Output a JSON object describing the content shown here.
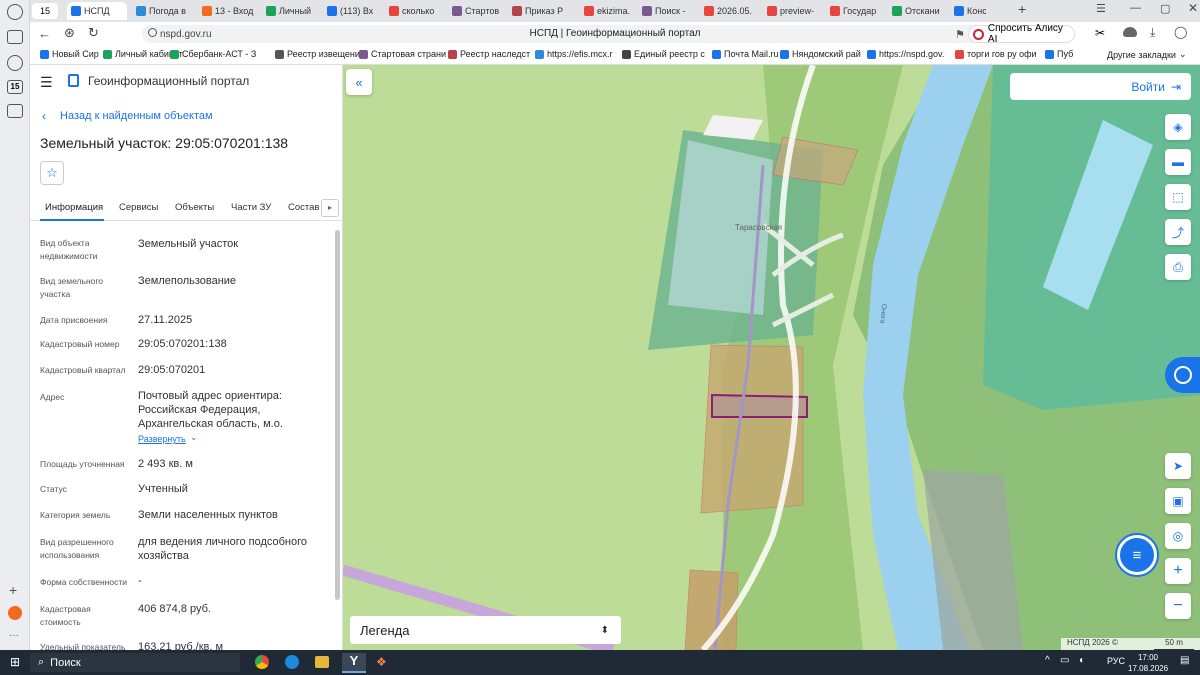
{
  "browser": {
    "tab_count": "15",
    "tabs": [
      {
        "label": "НСПД",
        "color": "#1a73e8"
      },
      {
        "label": "Погода в",
        "color": "#2e8bd6"
      },
      {
        "label": "13 - Вход",
        "color": "#f26b1d"
      },
      {
        "label": "Личный",
        "color": "#1aa35a"
      },
      {
        "label": "(113) Вх",
        "color": "#1a73e8"
      },
      {
        "label": "сколько",
        "color": "#e8453c"
      },
      {
        "label": "Стартов",
        "color": "#7a5a8c"
      },
      {
        "label": "Приказ Р",
        "color": "#b8424b"
      },
      {
        "label": "ekizima.",
        "color": "#e8453c"
      },
      {
        "label": "Поиск -",
        "color": "#7a5a8c"
      },
      {
        "label": "2026.05.",
        "color": "#e8453c"
      },
      {
        "label": "preview-",
        "color": "#e8453c"
      },
      {
        "label": "Государ",
        "color": "#e8453c"
      },
      {
        "label": "Отскани",
        "color": "#1aa35a"
      },
      {
        "label": "Консоль",
        "color": "#1a73e8"
      }
    ],
    "url": "nspd.gov.ru",
    "page_title": "НСПД | Геоинформационный портал",
    "alice_label": "Спросить Алису AI",
    "bookmarks": [
      {
        "label": "Новый Сир",
        "color": "#1a73e8"
      },
      {
        "label": "Личный кабинет",
        "color": "#1aa35a"
      },
      {
        "label": "Сбербанк-АСТ - З",
        "color": "#1aa35a"
      },
      {
        "label": "Реестр извещени",
        "color": "#555555"
      },
      {
        "label": "Стартовая страни",
        "color": "#7a5a8c"
      },
      {
        "label": "Реестр наследст",
        "color": "#b8424b"
      },
      {
        "label": "https://efis.mcx.r",
        "color": "#2e8bd6"
      },
      {
        "label": "Единый реестр с",
        "color": "#444444"
      },
      {
        "label": "Почта Mail.ru",
        "color": "#1a73e8"
      },
      {
        "label": "Няндомский рай",
        "color": "#1a73e8"
      },
      {
        "label": "https://nspd.gov.",
        "color": "#1a73e8"
      },
      {
        "label": "торги гов ру офи",
        "color": "#e8453c"
      },
      {
        "label": "Пуб",
        "color": "#1a73e8"
      }
    ],
    "other_bookmarks": "Другие закладки"
  },
  "app": {
    "title": "Геоинформационный портал",
    "back_link": "Назад к найденным объектам",
    "object_title": "Земельный участок: 29:05:070201:138",
    "tabs": [
      "Информация",
      "Сервисы",
      "Объекты",
      "Части ЗУ",
      "Состав"
    ],
    "fields": [
      {
        "label": "Вид объекта недвижимости",
        "value": "Земельный участок"
      },
      {
        "label": "Вид земельного участка",
        "value": "Землепользование"
      },
      {
        "label": "Дата присвоения",
        "value": "27.11.2025"
      },
      {
        "label": "Кадастровый номер",
        "value": "29:05:070201:138"
      },
      {
        "label": "Кадастровый квартал",
        "value": "29:05:070201"
      },
      {
        "label": "Адрес",
        "value": "Почтовый адрес ориентира: Российская Федерация, Архангельская область, м.о."
      },
      {
        "label": "Площадь уточненная",
        "value": "2 493 кв. м"
      },
      {
        "label": "Статус",
        "value": "Учтенный"
      },
      {
        "label": "Категория земель",
        "value": "Земли населенных пунктов"
      },
      {
        "label": "Вид разрешенного использования",
        "value": "для ведения личного подсобного хозяйства"
      },
      {
        "label": "Форма собственности",
        "value": "-"
      },
      {
        "label": "Кадастровая стоимость",
        "value": "406 874,8 руб."
      },
      {
        "label": "Удельный показатель",
        "value": "163,21 руб./кв. м"
      }
    ],
    "expand_link": "Развернуть"
  },
  "map": {
    "login": "Войти",
    "legend": "Легенда",
    "village_label": "Тарасовская",
    "river_label": "Онега",
    "copyright": "НСПД 2026 ©",
    "scale": "50 m"
  },
  "taskbar": {
    "search": "Поиск",
    "lang": "РУС",
    "time": "17:00",
    "date": "17.08.2026"
  }
}
